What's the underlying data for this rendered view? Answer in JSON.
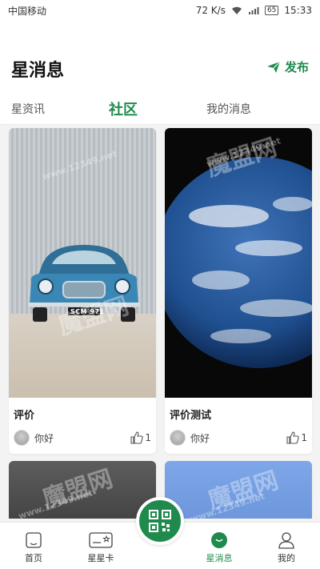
{
  "status_bar": {
    "carrier": "中国移动",
    "speed": "72 K/s",
    "battery": "65",
    "time": "15:33"
  },
  "header": {
    "title": "星消息",
    "publish_label": "发布"
  },
  "tabs": [
    {
      "label": "星资讯"
    },
    {
      "label": "社区",
      "active": true
    },
    {
      "label": "我的消息"
    }
  ],
  "feed": {
    "cards": [
      {
        "title": "评价",
        "author": "你好",
        "likes": "1",
        "image": "blue-classic-car",
        "plate": "SCM 971"
      },
      {
        "title": "评价测试",
        "author": "你好",
        "likes": "1",
        "image": "earth-from-space"
      }
    ]
  },
  "watermark": {
    "text": "魔盟网",
    "url": "www.12349.net"
  },
  "bottom_nav": [
    {
      "label": "首页",
      "icon": "home-icon"
    },
    {
      "label": "星星卡",
      "icon": "card-icon"
    },
    {
      "label": "星消息",
      "icon": "chat-bubble-icon",
      "active": true
    },
    {
      "label": "我的",
      "icon": "person-icon"
    }
  ],
  "colors": {
    "accent": "#1f8a4c",
    "background": "#f3f3f3"
  }
}
